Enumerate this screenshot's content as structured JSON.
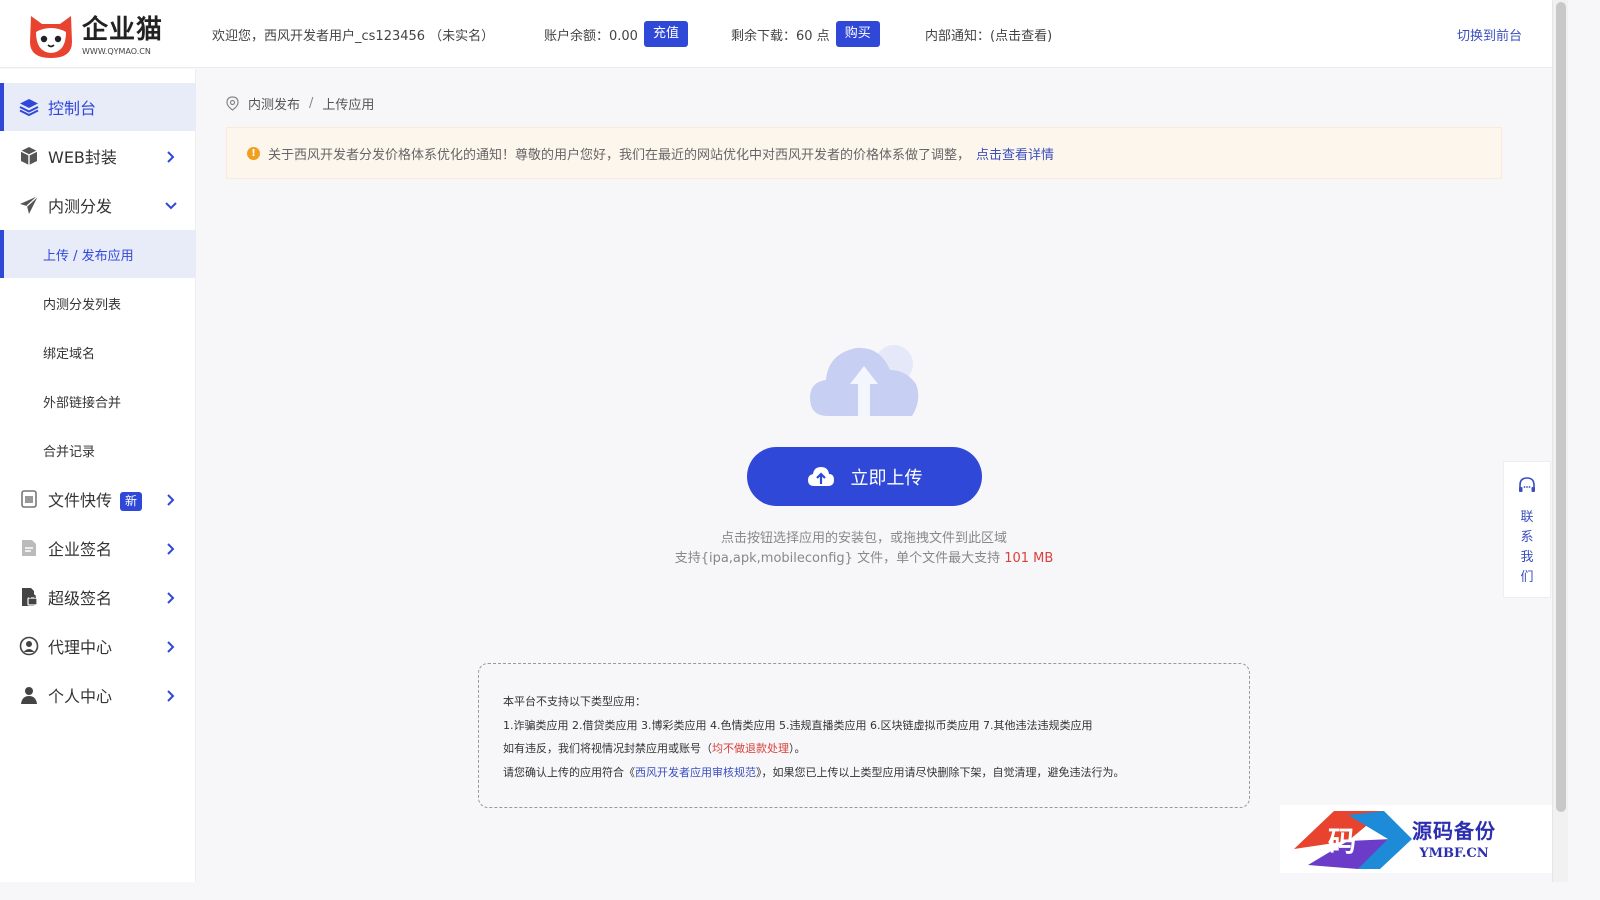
{
  "header": {
    "logo_name": "企业猫",
    "logo_url": "WWW.QYMAO.CN",
    "welcome": "欢迎您，西风开发者用户_cs123456 （未实名）",
    "balance_label": "账户余额：0.00",
    "recharge_label": "充值",
    "downloads_label": "剩余下载：60 点",
    "buy_label": "购买",
    "notice_label": "内部通知：(点击查看)",
    "switch_label": "切换到前台"
  },
  "sidebar": {
    "items": [
      {
        "label": "控制台",
        "icon": "layers-icon"
      },
      {
        "label": "WEB封装",
        "icon": "box-icon"
      },
      {
        "label": "内测分发",
        "icon": "paper-plane-icon"
      },
      {
        "label": "文件快传",
        "icon": "file-transfer-icon",
        "badge": "新"
      },
      {
        "label": "企业签名",
        "icon": "document-sign-icon"
      },
      {
        "label": "超级签名",
        "icon": "file-lock-icon"
      },
      {
        "label": "代理中心",
        "icon": "agent-icon"
      },
      {
        "label": "个人中心",
        "icon": "user-icon"
      }
    ],
    "sub_items": [
      {
        "label": "上传 / 发布应用"
      },
      {
        "label": "内测分发列表"
      },
      {
        "label": "绑定域名"
      },
      {
        "label": "外部链接合并"
      },
      {
        "label": "合并记录"
      }
    ]
  },
  "breadcrumb": {
    "parent": "内测发布",
    "separator": "/",
    "current": "上传应用"
  },
  "notice": {
    "text": "关于西风开发者分发价格体系优化的通知！尊敬的用户您好，我们在最近的网站优化中对西风开发者的价格体系做了调整，",
    "link": "点击查看详情"
  },
  "upload": {
    "button_label": "立即上传",
    "hint_line1": "点击按钮选择应用的安装包，或拖拽文件到此区域",
    "hint_line2_prefix": "支持{ipa,apk,mobileconfig} 文件，单个文件最大支持 ",
    "hint_line2_limit": "101 MB"
  },
  "rules": {
    "line1": "本平台不支持以下类型应用：",
    "line2": "1.诈骗类应用 2.借贷类应用 3.博彩类应用 4.色情类应用 5.违规直播类应用 6.区块链虚拟币类应用 7.其他违法违规类应用",
    "line3_prefix": "如有违反，我们将视情况封禁应用或账号（",
    "line3_red": "均不做退款处理",
    "line3_suffix": "）。",
    "line4_prefix": "请您确认上传的应用符合《",
    "line4_link": "西风开发者应用审核规范",
    "line4_suffix": "》，如果您已上传以上类型应用请尽快删除下架，自觉清理，避免违法行为。"
  },
  "contact": {
    "label": "联系我们"
  },
  "watermark": {
    "cn": "源码备份",
    "en": "YMBF.CN",
    "mark": "码"
  },
  "colors": {
    "primary": "#3048d8",
    "link": "#3b4fbf",
    "warning": "#f0a020",
    "danger": "#d9413c",
    "notice_bg": "#fdf6ec"
  }
}
